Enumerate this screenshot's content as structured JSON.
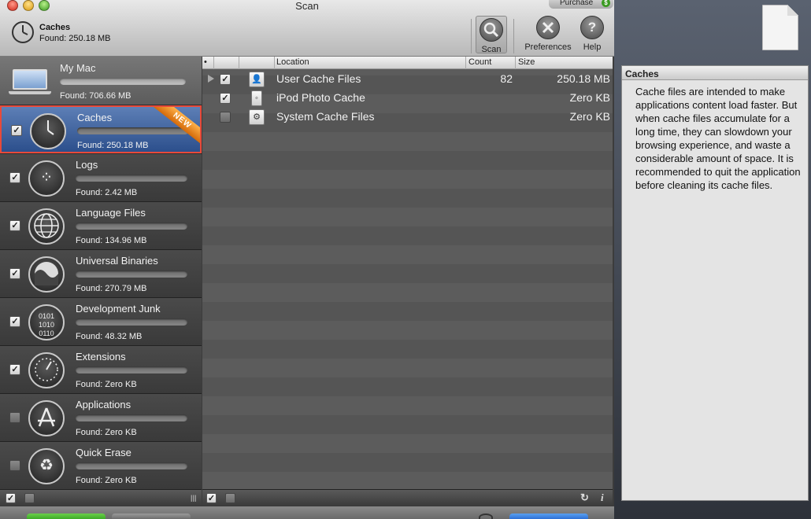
{
  "window": {
    "title": "Scan",
    "purchase_label": "Purchase",
    "purchase_icon": "$"
  },
  "status": {
    "title": "Caches",
    "found": "Found: 250.18 MB",
    "icon": "clock-icon"
  },
  "toolbar": {
    "scan_label": "Scan",
    "scan_icon": "magnifier-icon",
    "preferences_label": "Preferences",
    "preferences_icon": "tools-icon",
    "help_label": "Help",
    "help_icon": "?"
  },
  "my_mac": {
    "label": "My Mac",
    "found": "Found: 706.66 MB"
  },
  "sidebar_items": [
    {
      "label": "Caches",
      "found": "Found: 250.18 MB",
      "checked": true,
      "icon": "clock-icon",
      "badge": "NEW",
      "selected": true
    },
    {
      "label": "Logs",
      "found": "Found: 2.42 MB",
      "checked": true,
      "icon": "paw-icon"
    },
    {
      "label": "Language Files",
      "found": "Found: 134.96 MB",
      "checked": true,
      "icon": "globe-icon"
    },
    {
      "label": "Universal Binaries",
      "found": "Found: 270.79 MB",
      "checked": true,
      "icon": "universal-binary-icon"
    },
    {
      "label": "Development Junk",
      "found": "Found: 48.32 MB",
      "checked": true,
      "icon": "binary-disc-icon"
    },
    {
      "label": "Extensions",
      "found": "Found: Zero KB",
      "checked": true,
      "icon": "gauge-icon"
    },
    {
      "label": "Applications",
      "found": "Found: Zero KB",
      "checked": false,
      "icon": "app-store-icon"
    },
    {
      "label": "Quick Erase",
      "found": "Found: Zero KB",
      "checked": false,
      "icon": "recycle-icon"
    }
  ],
  "table": {
    "columns": {
      "bullet": "•",
      "location": "Location",
      "count": "Count",
      "size": "Size"
    },
    "rows": [
      {
        "name": "User Cache Files",
        "count": "82",
        "size": "250.18 MB",
        "checked": true,
        "expandable": true
      },
      {
        "name": "iPod Photo Cache",
        "count": "",
        "size": "Zero KB",
        "checked": true,
        "expandable": false
      },
      {
        "name": "System Cache Files",
        "count": "",
        "size": "Zero KB",
        "checked": false,
        "expandable": false
      }
    ]
  },
  "info": {
    "title": "Caches",
    "text": "Cache files are intended to make applications content load faster. But when cache files accumulate for a long time, they can slowdown your browsing experience, and waste a considerable amount of space. It is recommended to quit the application before cleaning its cache files."
  },
  "footer": {
    "checkmark": "✓",
    "refresh_icon": "↻",
    "info_icon": "i",
    "resize_icon": "|||"
  },
  "colors": {
    "selection": "#3a5f9e",
    "highlight_border": "#e84a3a",
    "new_badge": "#e8861e"
  }
}
